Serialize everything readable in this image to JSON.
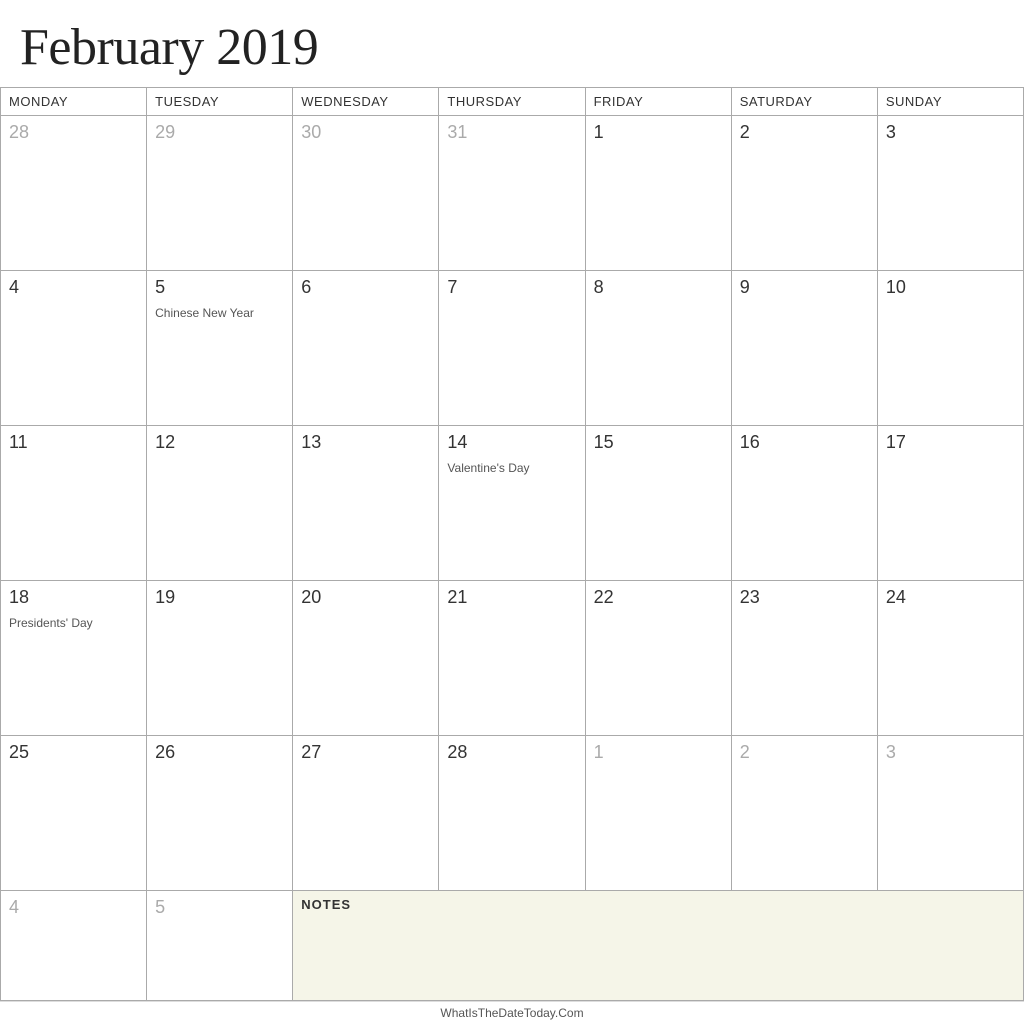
{
  "title": "February 2019",
  "headers": [
    "MONDAY",
    "TUESDAY",
    "WEDNESDAY",
    "THURSDAY",
    "FRIDAY",
    "SATURDAY",
    "SUNDAY"
  ],
  "weeks": [
    {
      "days": [
        {
          "number": "28",
          "otherMonth": true,
          "event": ""
        },
        {
          "number": "29",
          "otherMonth": true,
          "event": ""
        },
        {
          "number": "30",
          "otherMonth": true,
          "event": ""
        },
        {
          "number": "31",
          "otherMonth": true,
          "event": ""
        },
        {
          "number": "1",
          "otherMonth": false,
          "event": ""
        },
        {
          "number": "2",
          "otherMonth": false,
          "event": ""
        },
        {
          "number": "3",
          "otherMonth": false,
          "event": ""
        }
      ]
    },
    {
      "days": [
        {
          "number": "4",
          "otherMonth": false,
          "event": ""
        },
        {
          "number": "5",
          "otherMonth": false,
          "event": "Chinese New Year"
        },
        {
          "number": "6",
          "otherMonth": false,
          "event": ""
        },
        {
          "number": "7",
          "otherMonth": false,
          "event": ""
        },
        {
          "number": "8",
          "otherMonth": false,
          "event": ""
        },
        {
          "number": "9",
          "otherMonth": false,
          "event": ""
        },
        {
          "number": "10",
          "otherMonth": false,
          "event": ""
        }
      ]
    },
    {
      "days": [
        {
          "number": "11",
          "otherMonth": false,
          "event": ""
        },
        {
          "number": "12",
          "otherMonth": false,
          "event": ""
        },
        {
          "number": "13",
          "otherMonth": false,
          "event": ""
        },
        {
          "number": "14",
          "otherMonth": false,
          "event": "Valentine's Day"
        },
        {
          "number": "15",
          "otherMonth": false,
          "event": ""
        },
        {
          "number": "16",
          "otherMonth": false,
          "event": ""
        },
        {
          "number": "17",
          "otherMonth": false,
          "event": ""
        }
      ]
    },
    {
      "days": [
        {
          "number": "18",
          "otherMonth": false,
          "event": "Presidents' Day"
        },
        {
          "number": "19",
          "otherMonth": false,
          "event": ""
        },
        {
          "number": "20",
          "otherMonth": false,
          "event": ""
        },
        {
          "number": "21",
          "otherMonth": false,
          "event": ""
        },
        {
          "number": "22",
          "otherMonth": false,
          "event": ""
        },
        {
          "number": "23",
          "otherMonth": false,
          "event": ""
        },
        {
          "number": "24",
          "otherMonth": false,
          "event": ""
        }
      ]
    },
    {
      "days": [
        {
          "number": "25",
          "otherMonth": false,
          "event": ""
        },
        {
          "number": "26",
          "otherMonth": false,
          "event": ""
        },
        {
          "number": "27",
          "otherMonth": false,
          "event": ""
        },
        {
          "number": "28",
          "otherMonth": false,
          "event": ""
        },
        {
          "number": "1",
          "otherMonth": true,
          "event": ""
        },
        {
          "number": "2",
          "otherMonth": true,
          "event": ""
        },
        {
          "number": "3",
          "otherMonth": true,
          "event": ""
        }
      ]
    }
  ],
  "notes_row": [
    {
      "number": "4",
      "otherMonth": true,
      "event": ""
    },
    {
      "number": "5",
      "otherMonth": true,
      "event": ""
    },
    {
      "notes_label": "NOTES",
      "span": true
    }
  ],
  "footer": "WhatIsTheDateToday.Com"
}
